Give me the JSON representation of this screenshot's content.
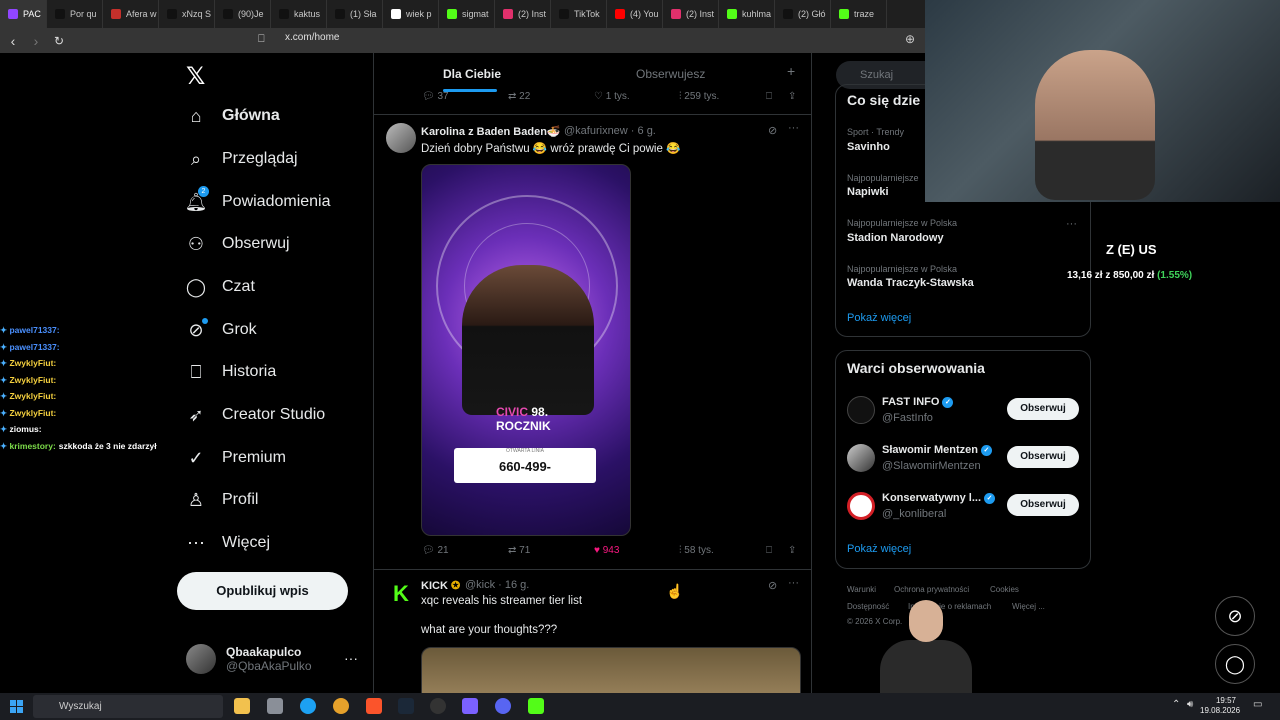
{
  "browser": {
    "tabs": [
      {
        "label": "PAC",
        "color": "#9146ff"
      },
      {
        "label": "Por qu",
        "color": "#111111"
      },
      {
        "label": "Afera w",
        "color": "#c4302b"
      },
      {
        "label": "xNzq S",
        "color": "#111111"
      },
      {
        "label": "(90)Je",
        "color": "#111111"
      },
      {
        "label": "kaktus",
        "color": "#111111"
      },
      {
        "label": "(1) Sła",
        "color": "#111111"
      },
      {
        "label": "wiek p",
        "color": "#ffffff"
      },
      {
        "label": "sigmat",
        "color": "#53fc18"
      },
      {
        "label": "(2) Inst",
        "color": "#e1306c"
      },
      {
        "label": "TikTok",
        "color": "#111111"
      },
      {
        "label": "(4) You",
        "color": "#ff0000"
      },
      {
        "label": "(2) Inst",
        "color": "#e1306c"
      },
      {
        "label": "kuhlma",
        "color": "#53fc18"
      },
      {
        "label": "(2) Głó",
        "color": "#111111"
      },
      {
        "label": "traze",
        "color": "#53fc18"
      }
    ],
    "url": "x.com/home"
  },
  "x": {
    "logo": "𝕏",
    "nav": [
      {
        "label": "Główna",
        "icon": "home-icon",
        "glyph": "⌂"
      },
      {
        "label": "Przeglądaj",
        "icon": "search-icon",
        "glyph": "⌕"
      },
      {
        "label": "Powiadomienia",
        "icon": "bell-icon",
        "glyph": "🔔︎",
        "badge": "2"
      },
      {
        "label": "Obserwuj",
        "icon": "follow-icon",
        "glyph": "⚇"
      },
      {
        "label": "Czat",
        "icon": "chat-icon",
        "glyph": "◯"
      },
      {
        "label": "Grok",
        "icon": "grok-icon",
        "glyph": "⊘"
      },
      {
        "label": "Historia",
        "icon": "bookmark-icon",
        "glyph": "⎕"
      },
      {
        "label": "Creator Studio",
        "icon": "rocket-icon",
        "glyph": "➶"
      },
      {
        "label": "Premium",
        "icon": "premium-icon",
        "glyph": "✓"
      },
      {
        "label": "Profil",
        "icon": "profile-icon",
        "glyph": "♙"
      },
      {
        "label": "Więcej",
        "icon": "more-circle-icon",
        "glyph": "⋯"
      }
    ],
    "post_button": "Opublikuj wpis",
    "me": {
      "name": "Qbaakapulco",
      "handle": "@QbaAkaPulko"
    },
    "feed_tabs": {
      "active": "Dla Ciebie",
      "other": "Obserwujesz",
      "plus": "+"
    },
    "top_actions": {
      "replies": "37",
      "reposts": "22",
      "likes": "1 tys.",
      "views": "259 tys."
    },
    "tweet1": {
      "name": "Karolina z Baden Baden🍜",
      "handle": "@kafurixnew · 6 g.",
      "text": "Dzień dobry Państwu 😂 wróż prawdę Ci powie 😂",
      "media_text_1": "CIVIC",
      "media_text_2": "98.",
      "media_text_3": "ROCZNIK",
      "media_phone_label": "OTWARTA LINIA",
      "media_phone": "660-499-",
      "actions": {
        "replies": "21",
        "reposts": "71",
        "likes": "943",
        "views": "58 tys."
      }
    },
    "tweet2": {
      "name": "KICK",
      "handle": "@kick · 16 g.",
      "text": "xqc reveals his streamer tier list",
      "text2": "what are your thoughts???"
    },
    "search_placeholder": "Szukaj",
    "trends_title": "Co się dzie",
    "trends": [
      {
        "meta": "Sport · Trendy",
        "name": "Savinho"
      },
      {
        "meta": "Najpopularniejsze",
        "name": "Napiwki"
      },
      {
        "meta": "Najpopularniejsze w Polska",
        "name": "Stadion Narodowy"
      },
      {
        "meta": "Najpopularniejsze w Polska",
        "name": "Wanda Traczyk-Stawska"
      }
    ],
    "show_more": "Pokaż więcej",
    "who_title": "Warci obserwowania",
    "who": [
      {
        "name": "FAST INFO",
        "handle": "@FastInfo",
        "button": "Obserwuj"
      },
      {
        "name": "Sławomir Mentzen",
        "handle": "@SlawomirMentzen",
        "button": "Obserwuj"
      },
      {
        "name": "Konserwatywny l...",
        "handle": "@_konliberal",
        "button": "Obserwuj"
      }
    ],
    "show_more2": "Pokaż więcej",
    "footer": [
      "Warunki",
      "Ochrona prywatności",
      "Cookies",
      "Dostępność",
      "Informacje o reklamach",
      "Więcej ...",
      "© 2026 X Corp."
    ]
  },
  "overlay": {
    "stock_title": "Z (E) US",
    "stock_price": "13,16 zł",
    "stock_sep": "z",
    "stock_total": "850,00 zł",
    "stock_change": "(1.55%)",
    "chat": [
      {
        "user": "pawel71337:",
        "cls": "u1",
        "msg": ""
      },
      {
        "user": "pawel71337:",
        "cls": "u1",
        "msg": ""
      },
      {
        "user": "ZwyklyFiut:",
        "cls": "u2",
        "msg": ""
      },
      {
        "user": "ZwyklyFiut:",
        "cls": "u2",
        "msg": ""
      },
      {
        "user": "ZwyklyFiut:",
        "cls": "u2",
        "msg": ""
      },
      {
        "user": "ZwyklyFiut:",
        "cls": "u2",
        "msg": ""
      },
      {
        "user": "ziomus:",
        "cls": "u3",
        "msg": ""
      },
      {
        "user": "krimestory:",
        "cls": "u4",
        "msg": "szkkoda że 3 nie zdarzył"
      }
    ]
  },
  "taskbar": {
    "search": "Wyszukaj",
    "time": "19:57",
    "date": "19.08.2026"
  }
}
